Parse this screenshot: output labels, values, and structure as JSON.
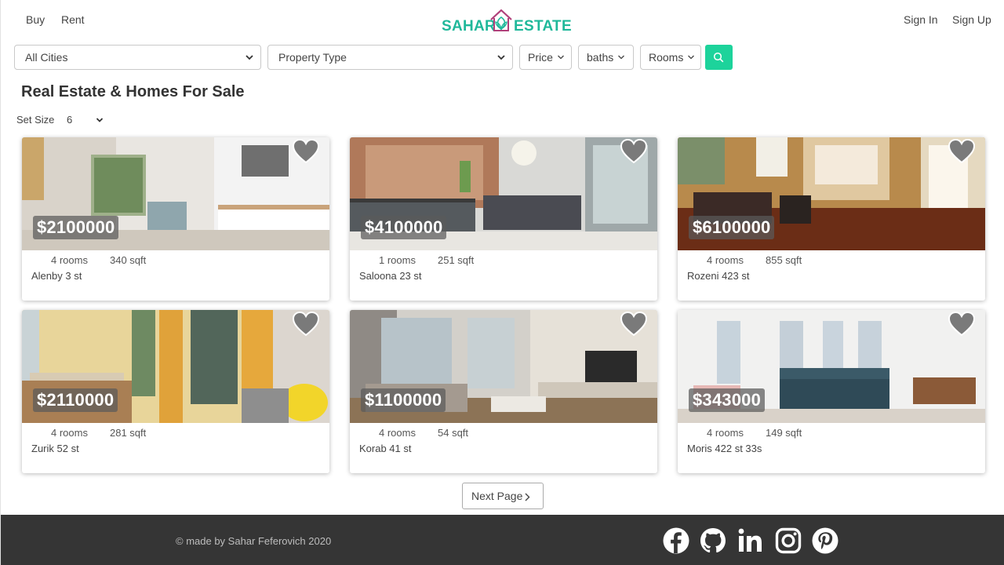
{
  "nav": {
    "buy": "Buy",
    "rent": "Rent",
    "sign_in": "Sign In",
    "sign_up": "Sign Up"
  },
  "logo": {
    "left": "SAHAR",
    "right": "ESTATE"
  },
  "filters": {
    "city": "All Cities",
    "property_type": "Property Type",
    "price": "Price",
    "baths": "baths",
    "rooms": "Rooms"
  },
  "page_title": "Real Estate & Homes For Sale",
  "set_size": {
    "label": "Set Size",
    "value": "6"
  },
  "listings": [
    {
      "price": "$2100000",
      "rooms": "4 rooms",
      "sqft": "340 sqft",
      "address": "Alenby 3 st"
    },
    {
      "price": "$4100000",
      "rooms": "1 rooms",
      "sqft": "251 sqft",
      "address": "Saloona 23 st"
    },
    {
      "price": "$6100000",
      "rooms": "4 rooms",
      "sqft": "855 sqft",
      "address": "Rozeni 423 st"
    },
    {
      "price": "$2110000",
      "rooms": "4 rooms",
      "sqft": "281 sqft",
      "address": "Zurik 52 st"
    },
    {
      "price": "$1100000",
      "rooms": "4 rooms",
      "sqft": "54 sqft",
      "address": "Korab 41 st"
    },
    {
      "price": "$343000",
      "rooms": "4 rooms",
      "sqft": "149 sqft",
      "address": "Moris 422 st 33s"
    }
  ],
  "next_page": "Next Page",
  "footer": {
    "copyright": "© made by Sahar Feferovich 2020",
    "social": [
      "facebook-icon",
      "github-icon",
      "linkedin-icon",
      "instagram-icon",
      "pinterest-icon"
    ]
  },
  "colors": {
    "brand": "#1fb89a",
    "search_button": "#1dd39b",
    "footer_bg": "#353535"
  }
}
